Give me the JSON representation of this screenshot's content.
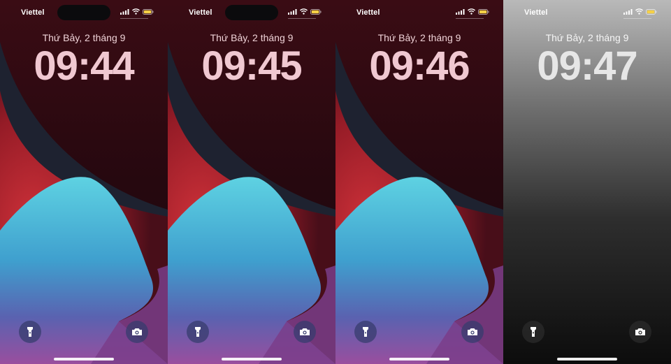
{
  "screens": [
    {
      "carrier": "Viettel",
      "date": "Thứ Bảy, 2 tháng 9",
      "time": "09:44",
      "theme": "color"
    },
    {
      "carrier": "Viettel",
      "date": "Thứ Bảy, 2 tháng 9",
      "time": "09:45",
      "theme": "color"
    },
    {
      "carrier": "Viettel",
      "date": "Thứ Bảy, 2 tháng 9",
      "time": "09:46",
      "theme": "color"
    },
    {
      "carrier": "Viettel",
      "date": "Thứ Bảy, 2 tháng 9",
      "time": "09:47",
      "theme": "gray"
    }
  ],
  "icons": {
    "signal": "cellular-signal-icon",
    "wifi": "wifi-icon",
    "battery": "battery-icon",
    "flashlight": "flashlight-icon",
    "camera": "camera-icon"
  },
  "colors": {
    "battery_fill": "#f5d046",
    "wall_red": "#b3202a",
    "wall_blue": "#4fc2d9",
    "wall_purple": "#8a4fb0",
    "wall_dark": "#1e2230"
  }
}
